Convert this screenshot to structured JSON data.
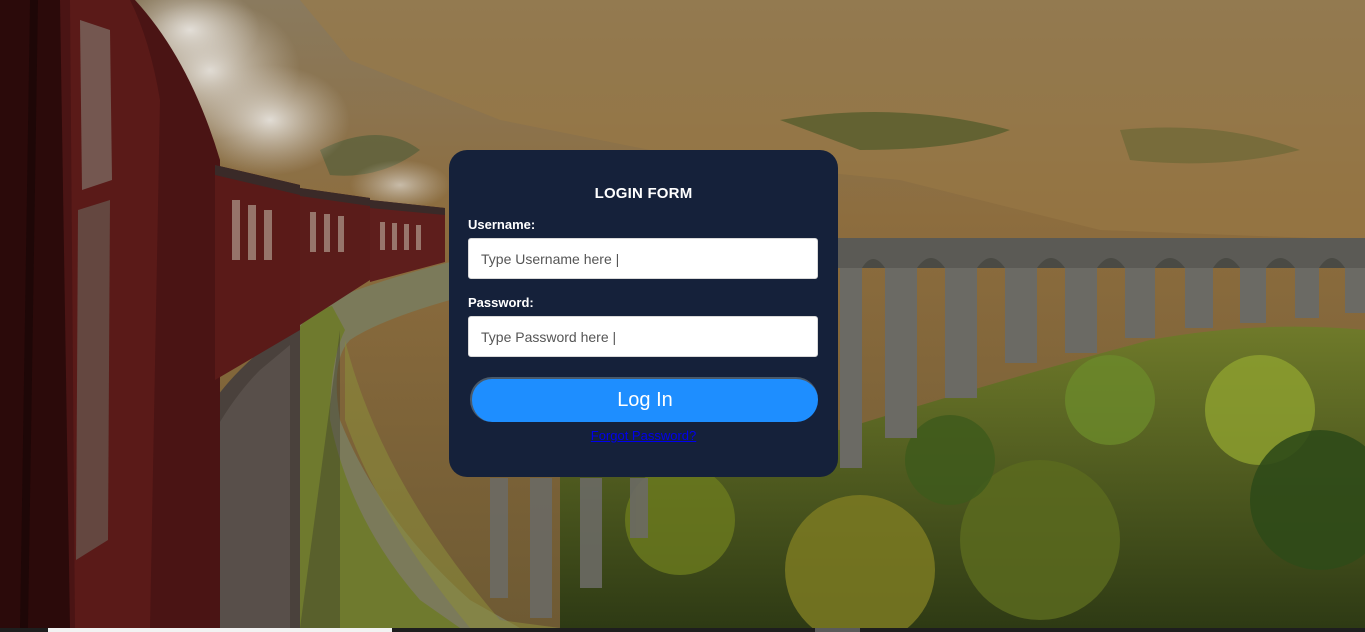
{
  "login_form": {
    "title": "LOGIN FORM",
    "username_label": "Username:",
    "username_placeholder": "Type Username here |",
    "username_value": "",
    "password_label": "Password:",
    "password_placeholder": "Type Password here |",
    "password_value": "",
    "submit_label": "Log In",
    "forgot_link": "Forgot Password?"
  },
  "colors": {
    "card_background": "#15213a",
    "button_background": "#1e8eff",
    "link_color": "#0000ee"
  }
}
